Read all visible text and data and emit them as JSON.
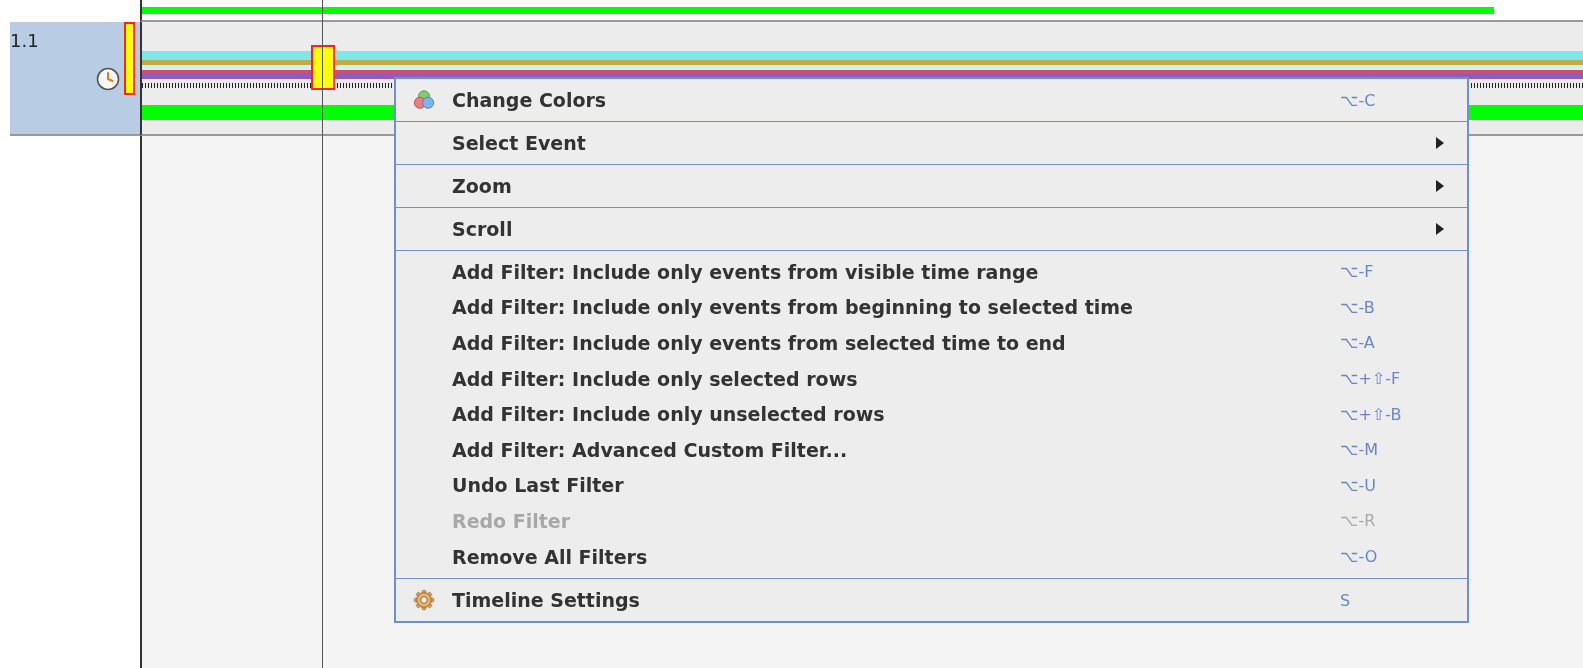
{
  "row_label": "1.1",
  "context_menu": {
    "sections": [
      {
        "items": [
          {
            "label": "Change Colors",
            "kind": "colors-command",
            "shortcut": "⌥-C",
            "disabled": false
          }
        ]
      },
      {
        "items": [
          {
            "label": "Select Event",
            "kind": "submenu",
            "disabled": false
          }
        ]
      },
      {
        "items": [
          {
            "label": "Zoom",
            "kind": "submenu",
            "disabled": false
          }
        ]
      },
      {
        "items": [
          {
            "label": "Scroll",
            "kind": "submenu",
            "disabled": false
          }
        ]
      },
      {
        "items": [
          {
            "label": "Add Filter: Include only events from visible time range",
            "kind": "command",
            "shortcut": "⌥-F",
            "disabled": false
          },
          {
            "label": "Add Filter: Include only events from beginning to selected time",
            "kind": "command",
            "shortcut": "⌥-B",
            "disabled": false
          },
          {
            "label": "Add Filter: Include only events from selected time to end",
            "kind": "command",
            "shortcut": "⌥-A",
            "disabled": false
          },
          {
            "label": "Add Filter: Include only selected rows",
            "kind": "command",
            "shortcut": "⌥+⇧-F",
            "disabled": false
          },
          {
            "label": "Add Filter: Include only unselected rows",
            "kind": "command",
            "shortcut": "⌥+⇧-B",
            "disabled": false
          },
          {
            "label": "Add Filter: Advanced Custom Filter...",
            "kind": "command",
            "shortcut": "⌥-M",
            "disabled": false
          },
          {
            "label": "Undo Last Filter",
            "kind": "command",
            "shortcut": "⌥-U",
            "disabled": false
          },
          {
            "label": "Redo Filter",
            "kind": "command",
            "shortcut": "⌥-R",
            "disabled": true
          },
          {
            "label": "Remove All Filters",
            "kind": "command",
            "shortcut": "⌥-O",
            "disabled": false
          }
        ]
      },
      {
        "items": [
          {
            "label": "Timeline Settings",
            "kind": "settings-command",
            "shortcut": "S",
            "disabled": false
          }
        ]
      }
    ]
  }
}
